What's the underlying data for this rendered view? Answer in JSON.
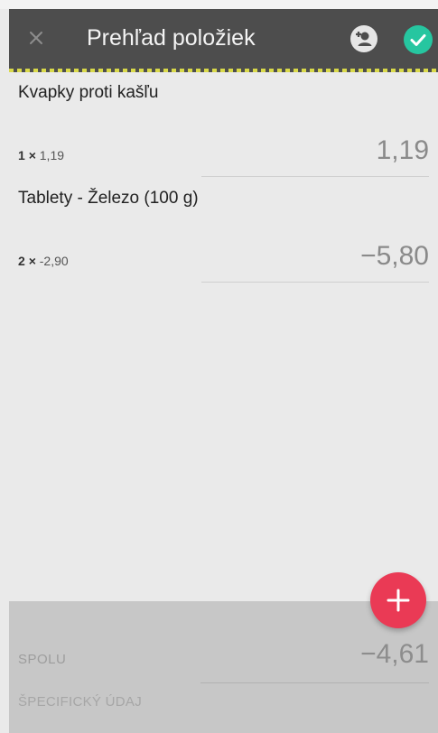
{
  "app_bar": {
    "title": "Prehľad položiek",
    "close_icon": "close-icon",
    "add_customer_icon": "add-person-icon",
    "confirm_icon": "check-icon",
    "background": "#4d4d4d",
    "confirm_color": "#26c6a0"
  },
  "items": [
    {
      "name": "Kvapky proti kašľu",
      "quantity": "1",
      "times": "×",
      "unit_price": "1,19",
      "total": "1,19"
    },
    {
      "name": "Tablety - Železo (100 g)",
      "quantity": "2",
      "times": "×",
      "unit_price": "-2,90",
      "total": "−5,80"
    }
  ],
  "footer": {
    "total_label": "SPOLU",
    "total_value": "−4,61",
    "specific_label": "ŠPECIFICKÝ ÚDAJ"
  },
  "fab": {
    "icon": "plus-icon",
    "color": "#ea3a55"
  }
}
